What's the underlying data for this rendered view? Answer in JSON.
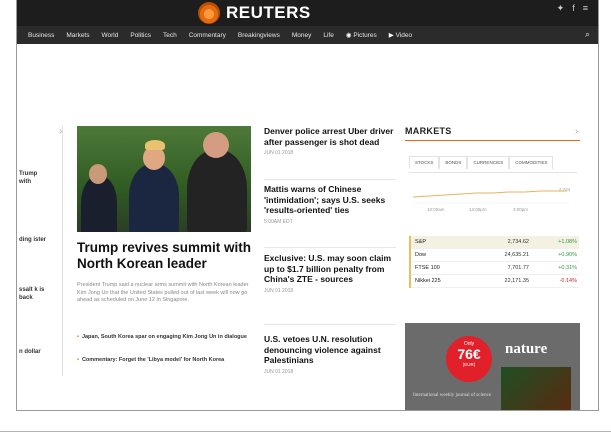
{
  "brand": {
    "name": "REUTERS"
  },
  "nav": {
    "items": [
      "Business",
      "Markets",
      "World",
      "Politics",
      "Tech",
      "Commentary",
      "Breakingviews",
      "Money",
      "Life"
    ],
    "pictures": "Pictures",
    "video": "Video"
  },
  "left_teasers": [
    "Trump with",
    "ding ister",
    "ssalt k is back",
    "n dollar"
  ],
  "lead": {
    "headline": "Trump revives summit with North Korean leader",
    "summary": "President Trump said a nuclear arms summit with North Korean leader Kim Jong Un that the United States pulled out of last week will now go ahead as scheduled on June 12 in Singapore.",
    "bullets": [
      "Japan, South Korea spar on engaging Kim Jong Un in dialogue",
      "Commentary: Forget the 'Libya model' for North Korea"
    ]
  },
  "stories": [
    {
      "title": "Denver police arrest Uber driver after passenger is shot dead",
      "date": "JUN 01 2018"
    },
    {
      "title": "Mattis warns of Chinese 'intimidation'; says U.S. seeks 'results-oriented' ties",
      "date": "5:00AM EDT"
    },
    {
      "title": "Exclusive: U.S. may soon claim up to $1.7 billion penalty from China's ZTE - sources",
      "date": "JUN 01 2018"
    },
    {
      "title": "U.S. vetoes U.N. resolution denouncing violence against Palestinians",
      "date": "JUN 01 2018"
    }
  ],
  "markets": {
    "title": "MARKETS",
    "tabs": [
      "STOCKS",
      "BONDS",
      "CURRENCIES",
      "COMMODITIES"
    ],
    "chart_value": "2,734",
    "chart_times": [
      "10:00am",
      "12:00pm",
      "2:00pm"
    ],
    "rows": [
      {
        "name": "S&P",
        "value": "2,734.62",
        "change": "+1.08%"
      },
      {
        "name": "Dow",
        "value": "24,635.21",
        "change": "+0.90%"
      },
      {
        "name": "FTSE 100",
        "value": "7,701.77",
        "change": "+0.31%"
      },
      {
        "name": "Nikkei 225",
        "value": "22,171.35",
        "change": "-0.14%"
      }
    ],
    "colors": {
      "up": "#2e9c44",
      "down": "#d2232a",
      "accent": "#e46b12"
    }
  },
  "ad": {
    "promo_top": "Only",
    "price": "76€",
    "promo_bottom": "(EUR)",
    "brand": "nature",
    "tagline": "International weekly journal of science"
  }
}
